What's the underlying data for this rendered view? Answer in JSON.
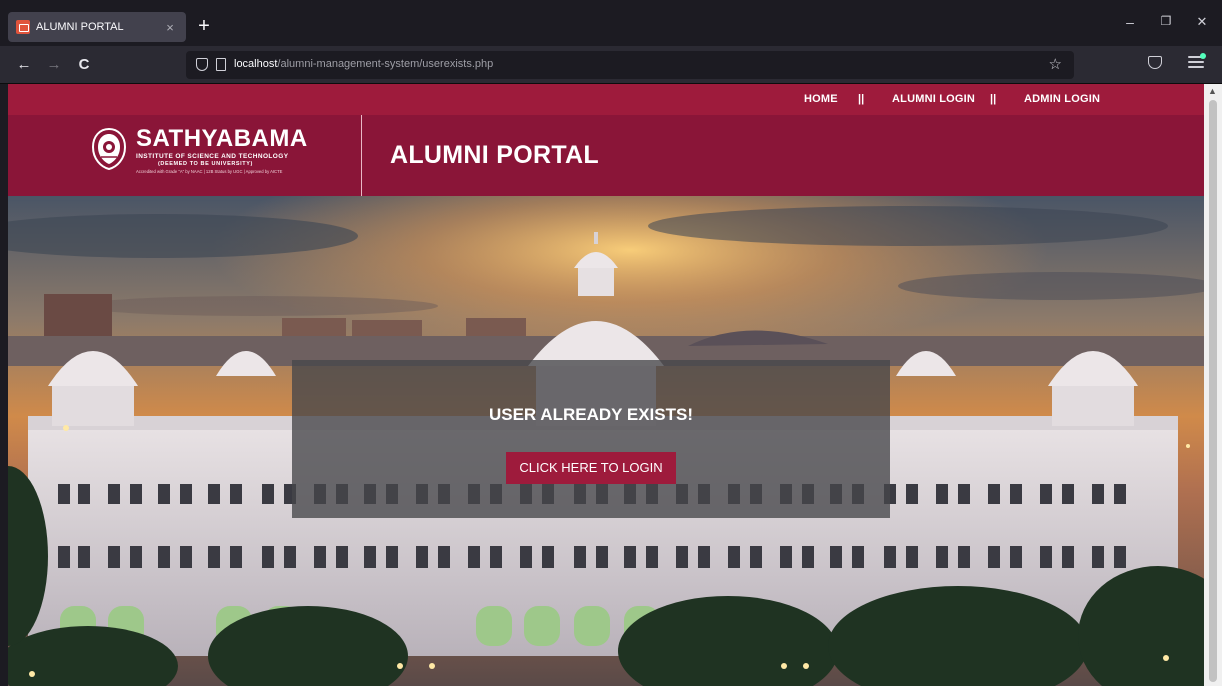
{
  "browser": {
    "tab_title": "ALUMNI PORTAL",
    "tab_close": "×",
    "new_tab": "+",
    "url_host": "localhost",
    "url_path": "/alumni-management-system/userexists.php",
    "back_icon": "←",
    "forward_icon": "→",
    "reload_icon": "C",
    "star_icon": "☆",
    "minimize_icon": "–",
    "restore_icon": "❐",
    "close_icon": "✕"
  },
  "nav": {
    "home": "HOME",
    "sep1": "||",
    "alumni_login": "ALUMNI LOGIN",
    "sep2": "||",
    "admin_login": "ADMIN LOGIN"
  },
  "header": {
    "brand_name": "SATHYABAMA",
    "brand_line1": "INSTITUTE OF SCIENCE AND TECHNOLOGY",
    "brand_line2": "(DEEMED TO BE UNIVERSITY)",
    "brand_line3": "Accredited with Grade \"A\" by NAAC | 12B Status by UGC | Approved by AICTE",
    "portal_title": "ALUMNI PORTAL"
  },
  "message": {
    "text": "USER ALREADY EXISTS!",
    "button_label": "CLICK HERE TO LOGIN"
  },
  "colors": {
    "maroon_nav": "#9e1b3c",
    "maroon_header": "#8a1538"
  }
}
